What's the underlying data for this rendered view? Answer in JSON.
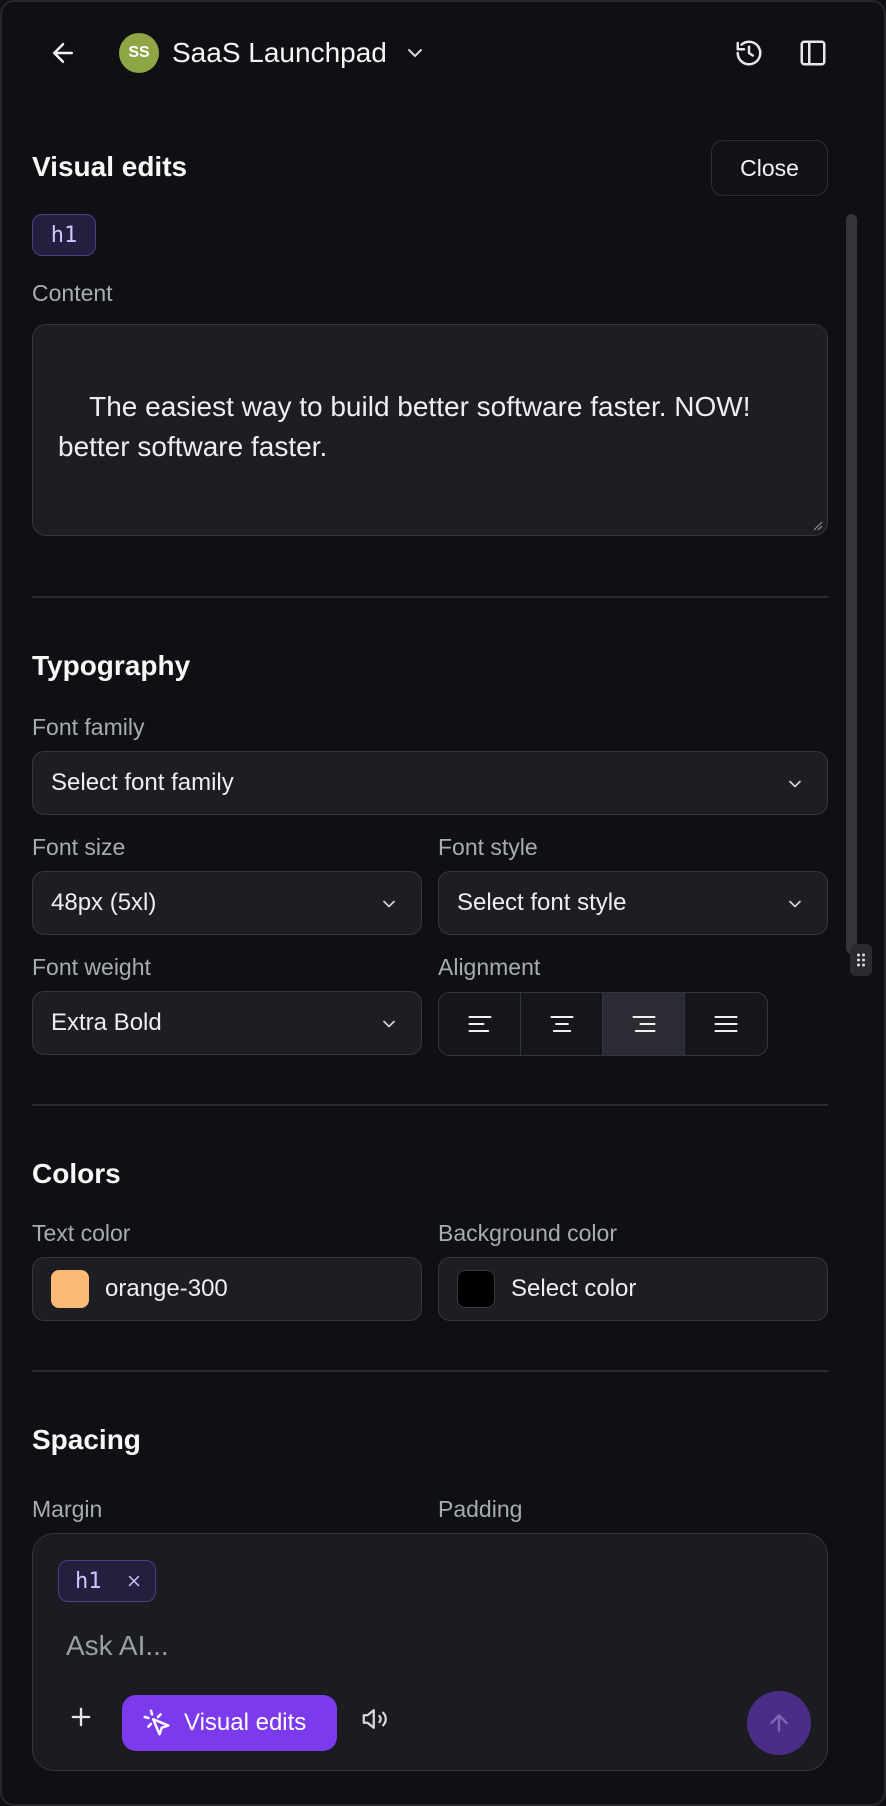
{
  "header": {
    "project_initials": "SS",
    "project_name": "SaaS Launchpad",
    "avatar_color": "#8fa646",
    "icons": [
      "arrow-left-icon",
      "chevron-down-icon",
      "history-icon",
      "sidebar-panel-icon"
    ]
  },
  "visual_edits": {
    "title": "Visual edits",
    "close_label": "Close",
    "element_tag": "h1",
    "content_label": "Content",
    "content_value": "The easiest way to build better software faster. NOW!\nbetter software faster."
  },
  "typography": {
    "title": "Typography",
    "font_family_label": "Font family",
    "font_family_value": "Select font family",
    "font_size_label": "Font size",
    "font_size_value": "48px (5xl)",
    "font_style_label": "Font style",
    "font_style_value": "Select font style",
    "font_weight_label": "Font weight",
    "font_weight_value": "Extra Bold",
    "alignment_label": "Alignment",
    "alignment_options": [
      "left",
      "center",
      "right",
      "justify"
    ],
    "alignment_selected": "right"
  },
  "colors": {
    "title": "Colors",
    "text_color_label": "Text color",
    "text_color_value": "orange-300",
    "text_color_swatch": "#fdba74",
    "background_color_label": "Background color",
    "background_color_value": "Select color",
    "background_color_swatch": "#000000"
  },
  "spacing": {
    "title": "Spacing",
    "margin_label": "Margin",
    "padding_label": "Padding"
  },
  "chat": {
    "tag": "h1",
    "placeholder": "Ask AI...",
    "visual_edits_label": "Visual edits",
    "accent": "#7b3bec"
  }
}
